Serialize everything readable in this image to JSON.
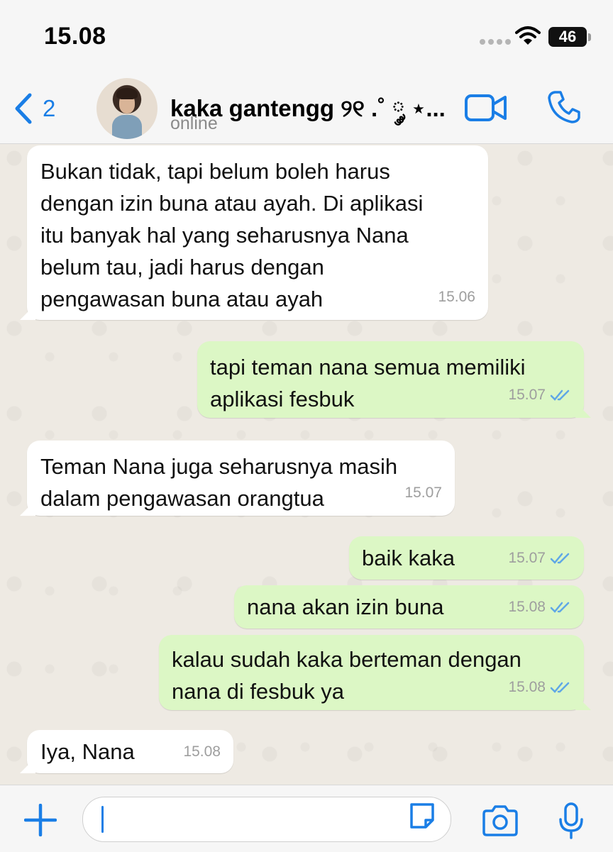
{
  "status_bar": {
    "time": "15.08",
    "battery": "46"
  },
  "header": {
    "back_count": "2",
    "contact_name": "kaka gantengg ୨୧ .˚ ༘ ⋆...",
    "contact_status": "online"
  },
  "messages": [
    {
      "direction": "in",
      "text": "Bukan tidak, tapi belum boleh harus\ndengan izin buna atau ayah. Di aplikasi\nitu banyak hal yang seharusnya Nana\nbelum tau, jadi harus dengan\npengawasan buna atau ayah",
      "time": "15.06"
    },
    {
      "direction": "out",
      "text": "tapi teman nana semua memiliki\naplikasi fesbuk",
      "time": "15.07",
      "read": true
    },
    {
      "direction": "in",
      "text": "Teman Nana juga seharusnya masih\ndalam pengawasan orangtua",
      "time": "15.07"
    },
    {
      "direction": "out",
      "text": "baik kaka",
      "time": "15.07",
      "read": true
    },
    {
      "direction": "out",
      "text": "nana akan izin buna",
      "time": "15.08",
      "read": true
    },
    {
      "direction": "out",
      "text": "kalau sudah kaka berteman dengan\nnana di fesbuk ya",
      "time": "15.08",
      "read": true
    },
    {
      "direction": "in",
      "text": "Iya, Nana",
      "time": "15.08"
    }
  ],
  "composer": {
    "value": ""
  },
  "colors": {
    "accent": "#1a7ee6",
    "incoming_bubble": "#ffffff",
    "outgoing_bubble": "#dcf7c5",
    "chat_background": "#eeeae3",
    "read_ticks": "#5fa7e6"
  },
  "icons": [
    "back-chevron-icon",
    "video-call-icon",
    "phone-icon",
    "plus-icon",
    "sticker-icon",
    "camera-icon",
    "microphone-icon",
    "double-check-icon"
  ]
}
